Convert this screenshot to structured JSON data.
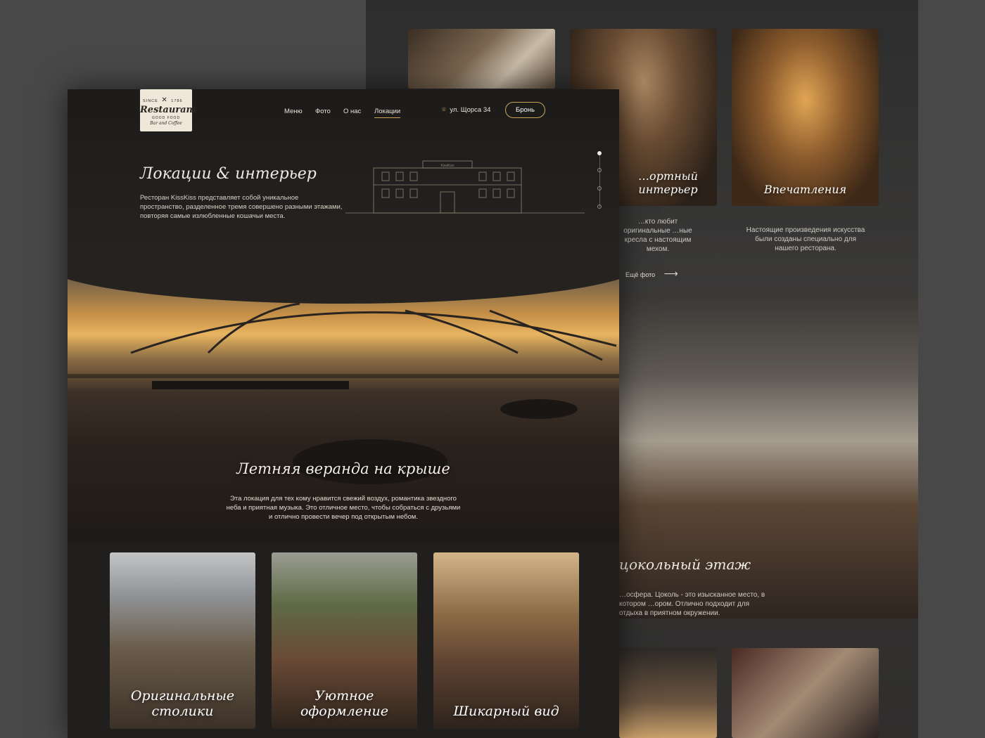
{
  "back_page": {
    "card_captions": [
      "…ортный интерьер",
      "Впечатления"
    ],
    "card_desc_1": "…кто любит оригинальные …ные кресла с настоящим мехом.",
    "card_desc_2": "Настоящие произведения искусства были созданы специально для нашего ресторана.",
    "more_photos": "Ещё фото",
    "basement_title": "цокольный этаж",
    "basement_desc": "…осфера. Цоколь - это изысканное место, в котором …ором. Отлично подходит для отдыха в приятном окружении."
  },
  "header": {
    "logo": {
      "since": "SINCE",
      "year": "1786",
      "brand": "Restaurant",
      "tagline": "GOOD FOOD",
      "sub": "Bar and Coffee"
    },
    "nav": [
      {
        "label": "Меню"
      },
      {
        "label": "Фото"
      },
      {
        "label": "О нас"
      },
      {
        "label": "Локации",
        "active": true
      }
    ],
    "address": "ул. Щорса 34",
    "book_button": "Бронь"
  },
  "intro": {
    "title": "Локации & интерьер",
    "description": "Ресторан KissKiss представляет собой уникальное пространство, разделенное тремя совершено разными этажами, повторяя самые излюбленные кошачьи места.",
    "building_sign": "KissKiss"
  },
  "veranda": {
    "title": "Летняя веранда на крыше",
    "description": "Эта локация для тех кому нравится свежий воздух, романтика звездного неба и приятная музыка. Это отличное место, чтобы собраться с друзьями и отлично провести вечер под открытым небом."
  },
  "gallery": [
    {
      "caption": "Оригинальные столики"
    },
    {
      "caption": "Уютное оформление"
    },
    {
      "caption": "Шикарный вид"
    }
  ],
  "colors": {
    "accent": "#c7a65c",
    "page_bg": "#484848",
    "front_bg": "#211f1e"
  }
}
